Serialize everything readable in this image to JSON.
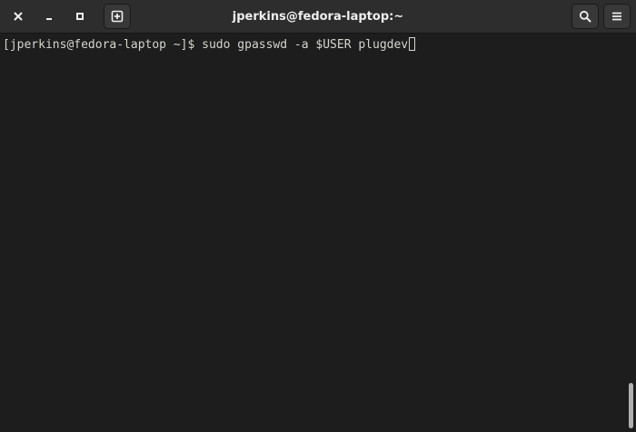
{
  "window": {
    "title": "jperkins@fedora-laptop:~"
  },
  "titlebar": {
    "buttons": {
      "close_icon": "close-icon",
      "minimize_icon": "minimize-icon",
      "maximize_icon": "maximize-icon",
      "new_tab_icon": "new-tab-icon",
      "search_icon": "search-icon",
      "menu_icon": "hamburger-menu-icon"
    }
  },
  "terminal": {
    "prompt": "[jperkins@fedora-laptop ~]$ ",
    "command": "sudo gpasswd -a $USER plugdev"
  },
  "colors": {
    "background": "#1d1d1d",
    "titlebar": "#2d2d2d",
    "text": "#d3d7cf",
    "title_text": "#eeeeec"
  }
}
